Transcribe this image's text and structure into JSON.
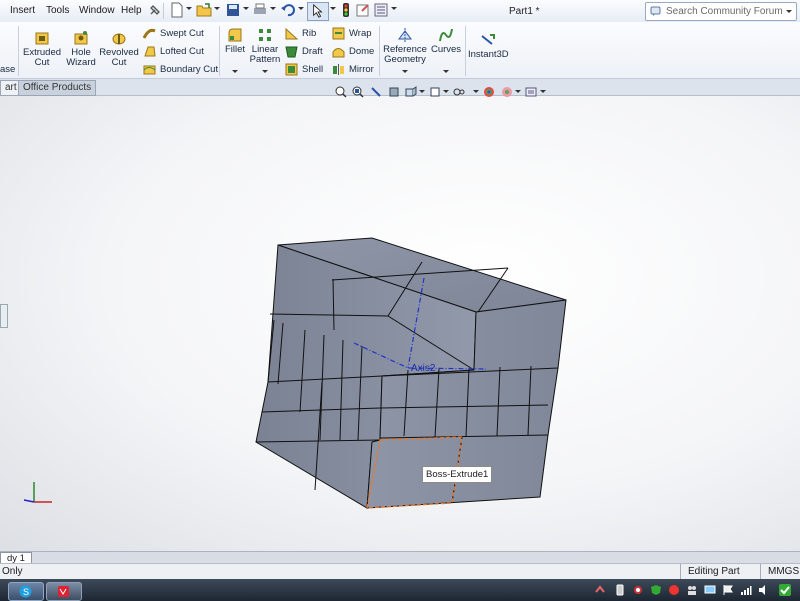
{
  "menu": {
    "items": [
      "Insert",
      "Tools",
      "Window",
      "Help"
    ]
  },
  "toolbar": {
    "icons": [
      "new-icon",
      "open-icon",
      "save-icon",
      "print-icon",
      "undo-icon",
      "select-icon",
      "rebuild-icon",
      "options-icon",
      "file-properties-icon"
    ]
  },
  "document": {
    "title": "Part1 *"
  },
  "search": {
    "placeholder": "Search Community Forum"
  },
  "ribbon": {
    "base_partial": "ase",
    "extruded_cut": "Extruded\nCut",
    "hole_wizard": "Hole\nWizard",
    "revolved_cut": "Revolved\nCut",
    "swept_cut": "Swept Cut",
    "lofted_cut": "Lofted Cut",
    "boundary_cut": "Boundary Cut",
    "fillet": "Fillet",
    "linear_pattern": "Linear\nPattern",
    "rib": "Rib",
    "draft": "Draft",
    "shell": "Shell",
    "wrap": "Wrap",
    "dome": "Dome",
    "mirror": "Mirror",
    "reference_geometry": "Reference\nGeometry",
    "curves": "Curves",
    "instant3d": "Instant3D"
  },
  "command_tabs": {
    "part_tab": "art",
    "office_tab": "Office Products"
  },
  "viewport": {
    "axis_label": "Axis2",
    "tooltip": "Boss-Extrude1"
  },
  "bottom_tab": {
    "label": "dy 1"
  },
  "status": {
    "left": "Only",
    "mode": "Editing Part",
    "units": "MMGS"
  },
  "colors": {
    "accent": "#2a4a7a",
    "highlight": "#e8792a",
    "cube": "#8e95a6"
  }
}
